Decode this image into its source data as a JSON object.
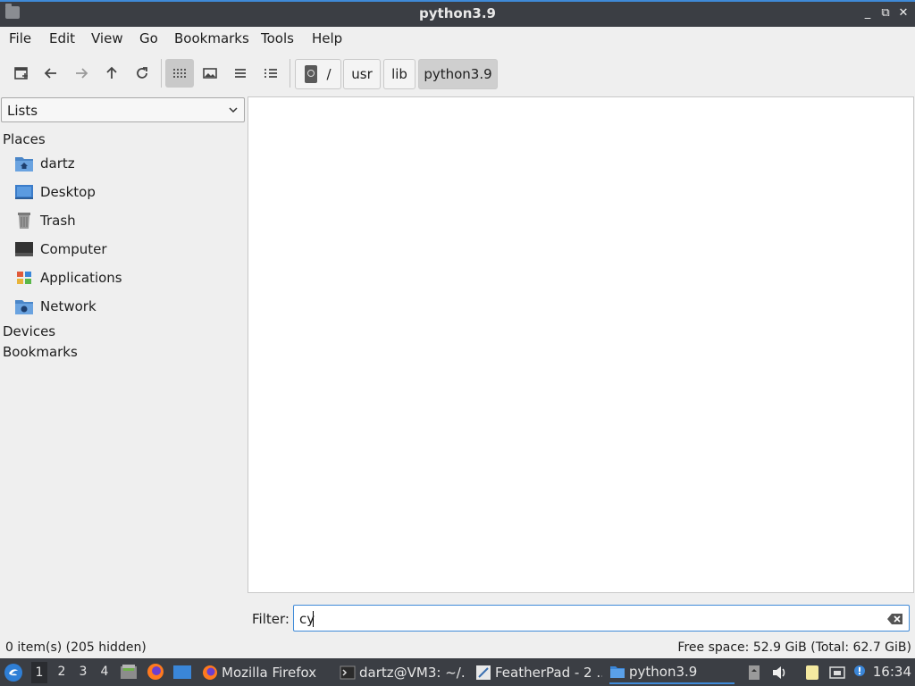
{
  "window": {
    "title": "python3.9",
    "controls": [
      "_",
      "⧉",
      "✕"
    ]
  },
  "menu": [
    "File",
    "Edit",
    "View",
    "Go",
    "Bookmarks",
    "Tools",
    "Help"
  ],
  "breadcrumb": [
    "/",
    "usr",
    "lib",
    "python3.9"
  ],
  "sidebar": {
    "combo_value": "Lists",
    "places_header": "Places",
    "places": [
      {
        "label": "dartz",
        "icon": "home-folder-icon"
      },
      {
        "label": "Desktop",
        "icon": "desktop-icon"
      },
      {
        "label": "Trash",
        "icon": "trash-icon"
      },
      {
        "label": "Computer",
        "icon": "computer-icon"
      },
      {
        "label": "Applications",
        "icon": "applications-icon"
      },
      {
        "label": "Network",
        "icon": "network-folder-icon"
      }
    ],
    "devices_header": "Devices",
    "bookmarks_header": "Bookmarks"
  },
  "filter": {
    "label": "Filter:",
    "value": "cy"
  },
  "status": {
    "items": "0 item(s) (205 hidden)",
    "free_space": "Free space: 52.9 GiB (Total: 62.7 GiB)"
  },
  "taskbar": {
    "workspaces": [
      "1",
      "2",
      "3",
      "4"
    ],
    "active_workspace": "1",
    "tasks": [
      {
        "label": "Mozilla Firefox",
        "icon": "firefox-icon"
      },
      {
        "label": "dartz@VM3: ~/...",
        "icon": "terminal-icon"
      },
      {
        "label": "FeatherPad - 2 ...",
        "icon": "featherpad-icon"
      },
      {
        "label": "python3.9",
        "icon": "folder-icon"
      }
    ],
    "clock": "16:34"
  }
}
